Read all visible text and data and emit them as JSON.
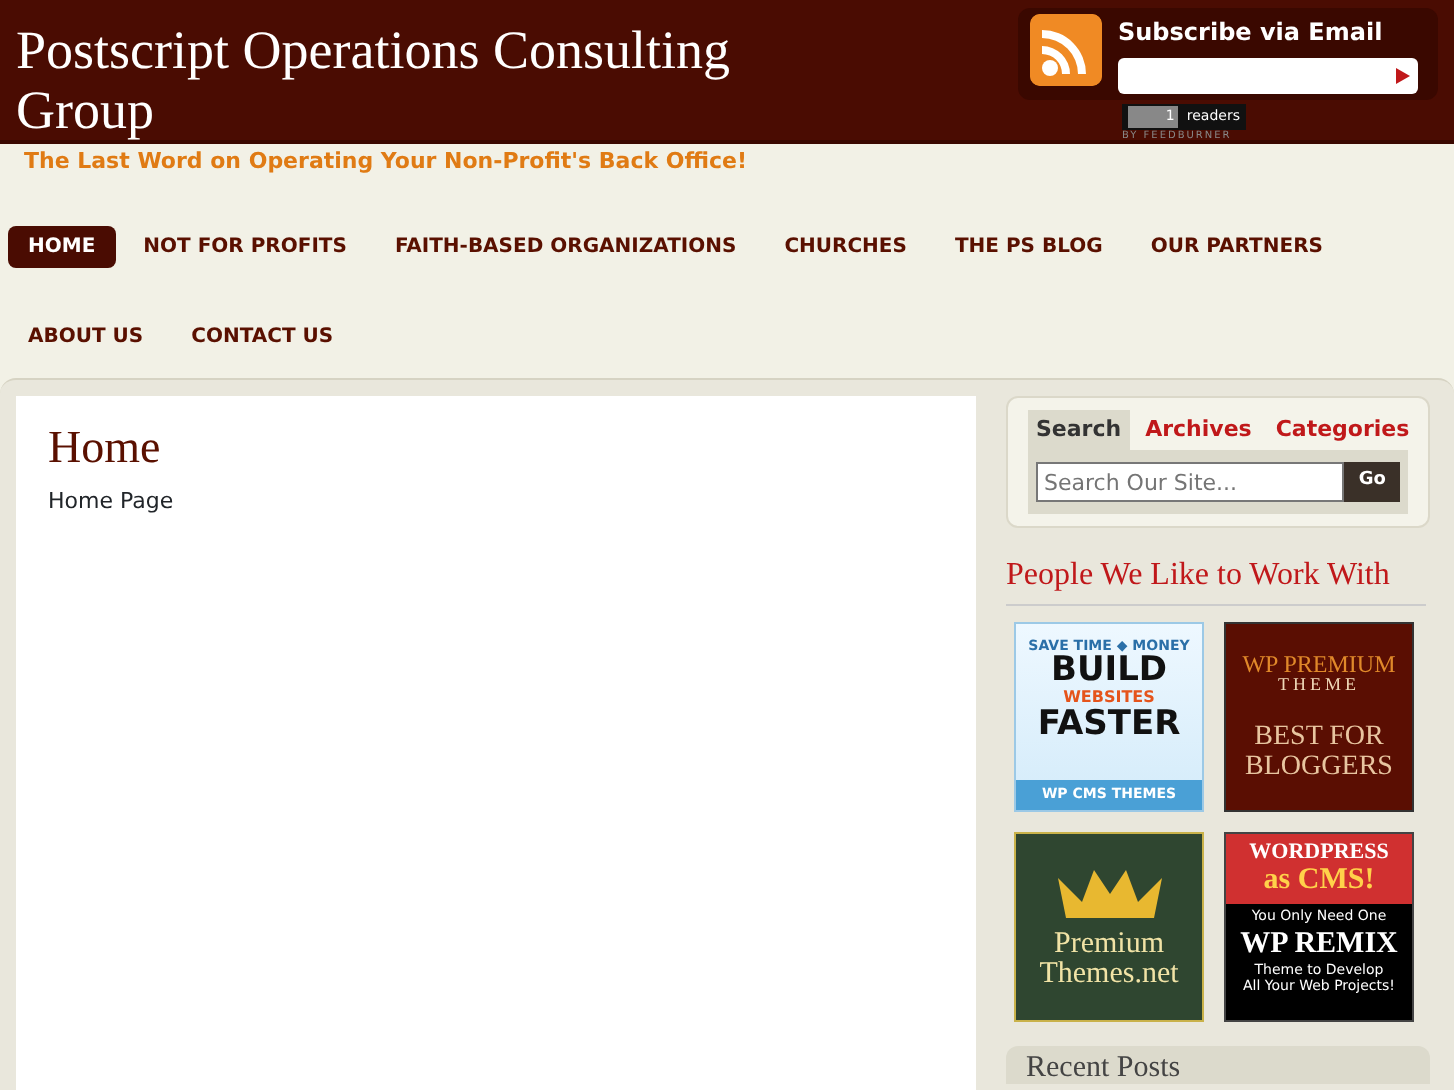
{
  "header": {
    "title": "Postscript Operations Consulting Group",
    "subscribe_title": "Subscribe via Email",
    "reader_count": "1",
    "readers_label": "readers",
    "feed_credit": "BY FEEDBURNER"
  },
  "tagline": "The Last Word on Operating Your Non-Profit's Back Office!",
  "nav": [
    {
      "label": "HOME",
      "selected": true
    },
    {
      "label": "NOT FOR PROFITS",
      "selected": false
    },
    {
      "label": "FAITH-BASED ORGANIZATIONS",
      "selected": false
    },
    {
      "label": "CHURCHES",
      "selected": false
    },
    {
      "label": "THE PS BLOG",
      "selected": false
    },
    {
      "label": "OUR PARTNERS",
      "selected": false
    },
    {
      "label": "ABOUT US",
      "selected": false
    },
    {
      "label": "CONTACT US",
      "selected": false
    }
  ],
  "main": {
    "heading": "Home",
    "text": "Home Page"
  },
  "sidebar": {
    "tabs": [
      {
        "label": "Search",
        "selected": true
      },
      {
        "label": "Archives",
        "selected": false
      },
      {
        "label": "Categories",
        "selected": false
      }
    ],
    "search": {
      "placeholder": "Search Our Site...",
      "button": "Go"
    },
    "partners_title": "People We Like to Work With",
    "ads": [
      {
        "kind": "build",
        "lines": [
          "SAVE TIME ◆ MONEY",
          "BUILD",
          "WEBSITES",
          "FASTER",
          "WP CMS THEMES"
        ]
      },
      {
        "kind": "premium",
        "lines": [
          "WP PREMIUM",
          "THEME",
          "BEST FOR",
          "BLOGGERS"
        ]
      },
      {
        "kind": "crown",
        "lines": [
          "Premium",
          "Themes.net"
        ]
      },
      {
        "kind": "remix",
        "lines": [
          "WORDPRESS",
          "as CMS!",
          "You Only Need One",
          "WP REMIX",
          "Theme  to Develop",
          "All Your Web Projects!"
        ]
      }
    ],
    "recent_title": "Recent Posts"
  }
}
